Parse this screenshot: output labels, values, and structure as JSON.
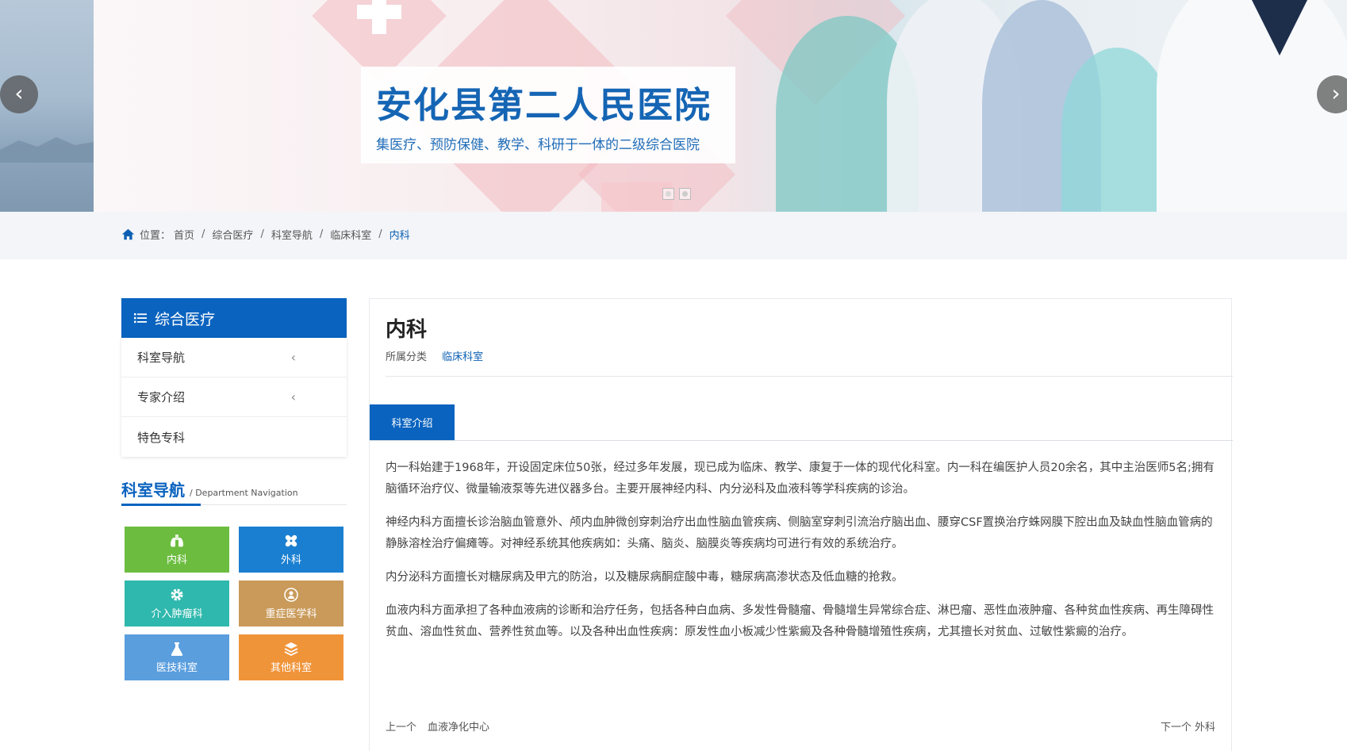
{
  "banner": {
    "title": "安化县第二人民医院",
    "subtitle": "集医疗、预防保健、教学、科研于一体的二级综合医院",
    "prev_icon": "‹",
    "next_icon": "›",
    "slide_count": 2,
    "active_slide": 1
  },
  "breadcrumb": {
    "label": "位置：",
    "items": [
      "首页",
      "综合医疗",
      "科室导航",
      "临床科室",
      "内科"
    ],
    "separator": "/"
  },
  "sidebar": {
    "title": "综合医疗",
    "items": [
      {
        "label": "科室导航",
        "chevron": "‹"
      },
      {
        "label": "专家介绍",
        "chevron": "‹"
      },
      {
        "label": "特色专科",
        "chevron": ""
      }
    ]
  },
  "dept_nav": {
    "title": "科室导航",
    "subtitle": "/ Department Navigation",
    "tiles": [
      {
        "label": "内科",
        "icon": "lungs-icon",
        "color": "#6cbd3f"
      },
      {
        "label": "外科",
        "icon": "bandage-icon",
        "color": "#1a7fd0"
      },
      {
        "label": "介入肿瘤科",
        "icon": "gear-icon",
        "color": "#2fb8ad"
      },
      {
        "label": "重症医学科",
        "icon": "head-icon",
        "color": "#c99a59"
      },
      {
        "label": "医技科室",
        "icon": "flask-icon",
        "color": "#5a9ede"
      },
      {
        "label": "其他科室",
        "icon": "layers-icon",
        "color": "#f0943a"
      }
    ]
  },
  "article": {
    "title": "内科",
    "category_label": "所属分类",
    "category": "临床科室",
    "tab": "科室介绍",
    "paragraphs": [
      "内一科始建于1968年，开设固定床位50张，经过多年发展，现已成为临床、教学、康复于一体的现代化科室。内一科在编医护人员20余名，其中主治医师5名;拥有脑循环治疗仪、微量输液泵等先进仪器多台。主要开展神经内科、内分泌科及血液科等学科疾病的诊治。",
      "神经内科方面擅长诊治脑血管意外、颅内血肿微创穿刺治疗出血性脑血管疾病、侧脑室穿刺引流治疗脑出血、腰穿CSF置换治疗蛛网膜下腔出血及缺血性脑血管病的静脉溶栓治疗偏瘫等。对神经系统其他疾病如：头痛、脑炎、脑膜炎等疾病均可进行有效的系统治疗。",
      "内分泌科方面擅长对糖尿病及甲亢的防治，以及糖尿病酮症酸中毒，糖尿病高渗状态及低血糖的抢救。",
      "血液内科方面承担了各种血液病的诊断和治疗任务，包括各种白血病、多发性骨髓瘤、骨髓增生异常综合症、淋巴瘤、恶性血液肿瘤、各种贫血性疾病、再生障碍性贫血、溶血性贫血、营养性贫血等。以及各种出血性疾病：原发性血小板减少性紫癜及各种骨髓增殖性疾病，尤其擅长对贫血、过敏性紫癜的治疗。"
    ],
    "prev_label": "上一个",
    "prev_title": "血液净化中心",
    "next_label": "下一个",
    "next_title": "外科"
  }
}
